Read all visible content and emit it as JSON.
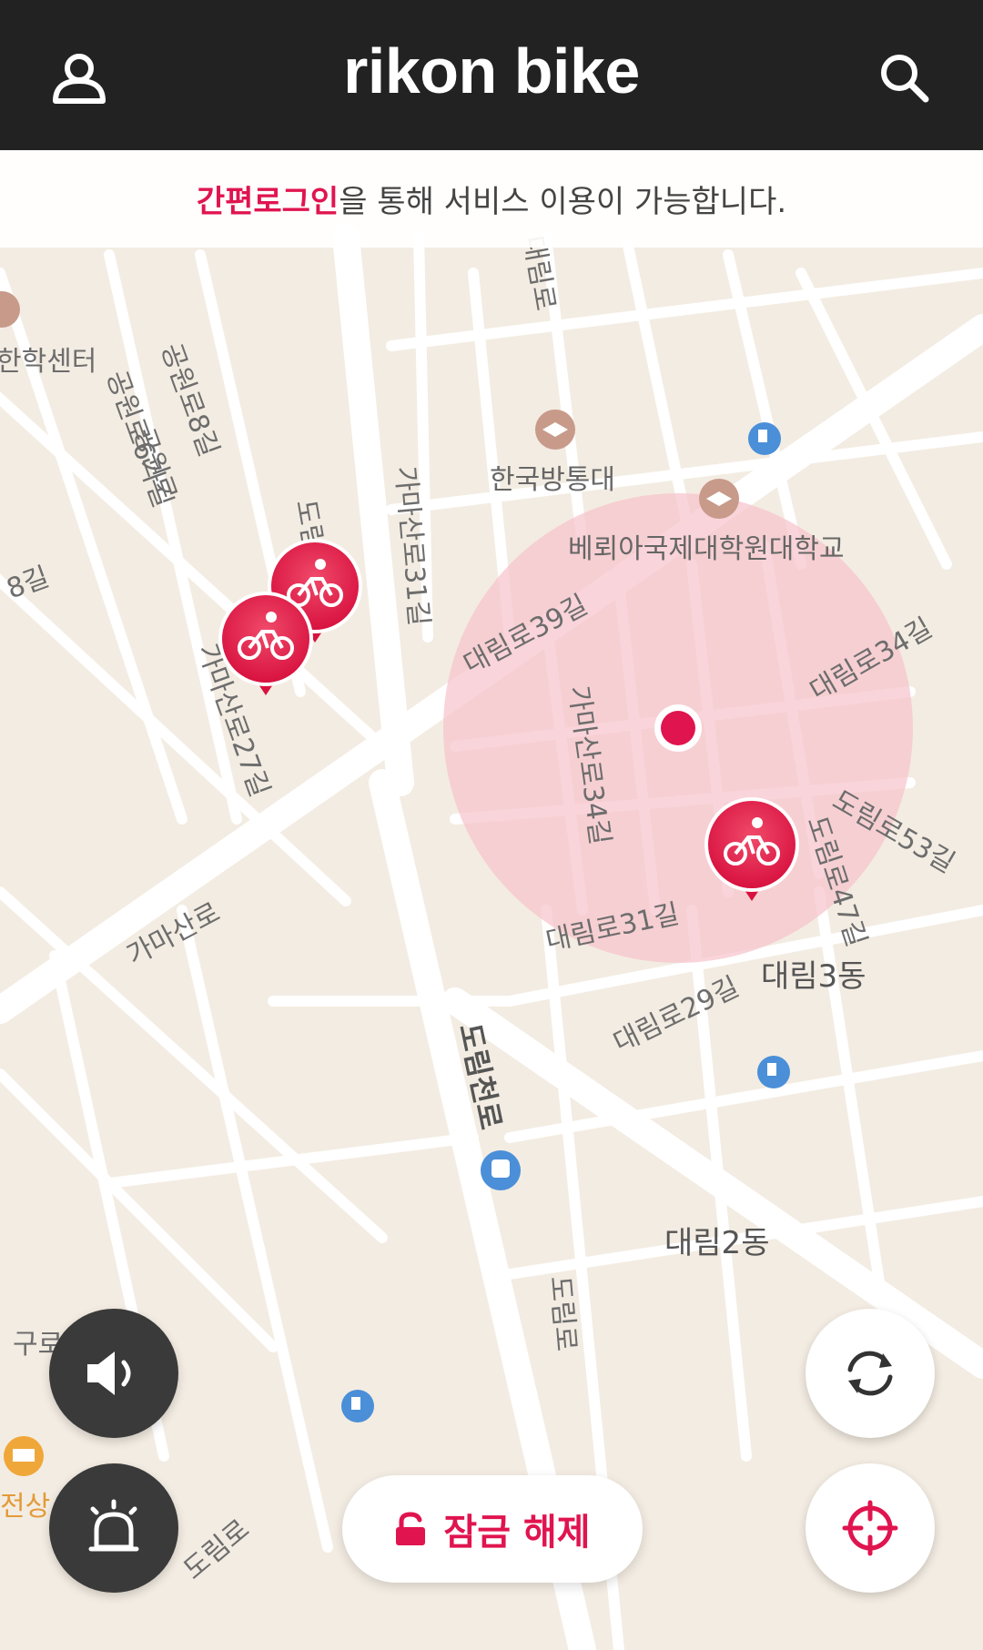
{
  "header": {
    "title": "rikon bike",
    "profile_icon": "user-icon",
    "search_icon": "search-icon"
  },
  "banner": {
    "accent": "간편로그인",
    "text": "을 통해 서비스 이용이 가능합니다."
  },
  "map": {
    "labels": {
      "center_partial": "한학센터",
      "gongwon8": "공원로8길",
      "gongwon6": "공원로6가길",
      "gongwon": "공원로",
      "gama31": "가마산로31길",
      "gama27": "가마산로27길",
      "gama34": "가마산로34길",
      "gama": "가마산로",
      "daerim39": "대림로39길",
      "daerim31": "대림로31길",
      "daerim29": "대림로29길",
      "daerim34": "대림로34길",
      "dorim53": "도림로53길",
      "dorim47": "도림로47길",
      "dorimcheon": "도림천로",
      "dorim": "도림로",
      "daerim3": "대림3동",
      "daerim2": "대림2동",
      "knou": "한국방통대",
      "veritas": "베뢰아국제대학원대학교",
      "gu_partial": "구로",
      "jeonsang_partial": "전상",
      "top_road": "대림로",
      "left_road": "8길",
      "dorim_short": "도림",
      "dorim_bottom": "도림로"
    },
    "accent_color": "#e0144f",
    "radius_color": "#f6c3cc"
  },
  "controls": {
    "sound_icon": "speaker-icon",
    "alarm_icon": "siren-icon",
    "refresh_icon": "refresh-icon",
    "locate_icon": "crosshair-icon",
    "unlock_icon": "unlock-icon",
    "unlock_label": "잠금 해제"
  }
}
